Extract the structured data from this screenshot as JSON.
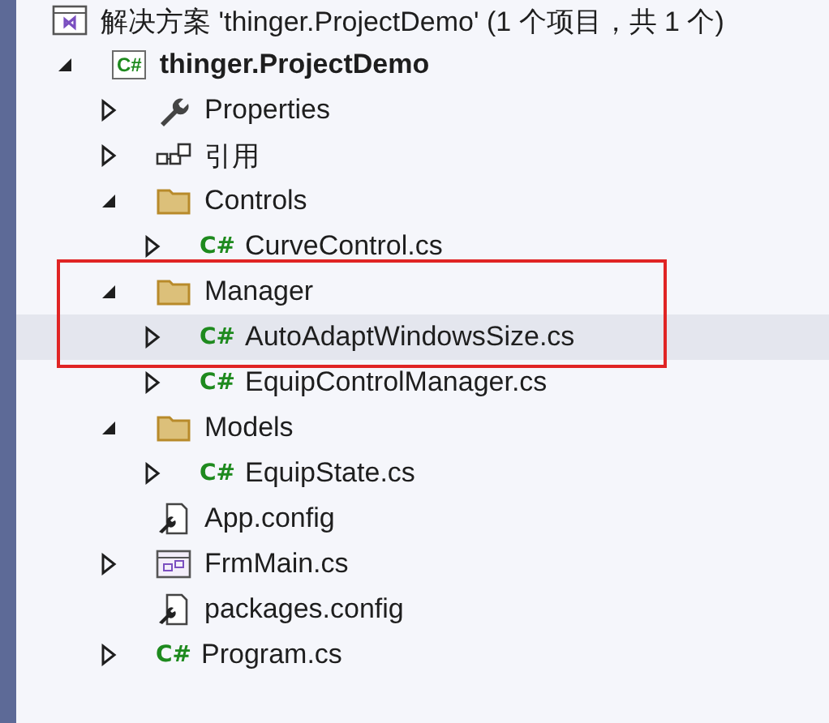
{
  "solution": {
    "title": "解决方案 'thinger.ProjectDemo' (1 个项目，共 1 个)"
  },
  "tree": [
    {
      "label": "thinger.ProjectDemo",
      "kind": "project",
      "badge": "C#",
      "expanded": true,
      "selected": false,
      "children": [
        {
          "label": "Properties",
          "kind": "wrench",
          "expanded": false,
          "selected": false
        },
        {
          "label": "引用",
          "kind": "references",
          "expanded": false,
          "selected": false
        },
        {
          "label": "Controls",
          "kind": "folder",
          "expanded": true,
          "selected": false,
          "children": [
            {
              "label": "CurveControl.cs",
              "kind": "cs",
              "badge": "C#",
              "expanded": false,
              "selected": false
            }
          ]
        },
        {
          "label": "Manager",
          "kind": "folder",
          "expanded": true,
          "selected": false,
          "children": [
            {
              "label": "AutoAdaptWindowsSize.cs",
              "kind": "cs",
              "badge": "C#",
              "expanded": false,
              "selected": true
            },
            {
              "label": "EquipControlManager.cs",
              "kind": "cs",
              "badge": "C#",
              "expanded": false,
              "selected": false
            }
          ]
        },
        {
          "label": "Models",
          "kind": "folder",
          "expanded": true,
          "selected": false,
          "children": [
            {
              "label": "EquipState.cs",
              "kind": "cs",
              "badge": "C#",
              "expanded": false,
              "selected": false
            }
          ]
        },
        {
          "label": "App.config",
          "kind": "config",
          "selected": false
        },
        {
          "label": "FrmMain.cs",
          "kind": "form",
          "expanded": false,
          "selected": false
        },
        {
          "label": "packages.config",
          "kind": "config",
          "selected": false
        },
        {
          "label": "Program.cs",
          "kind": "cs",
          "badge": "C#",
          "expanded": false,
          "selected": false
        }
      ]
    }
  ]
}
